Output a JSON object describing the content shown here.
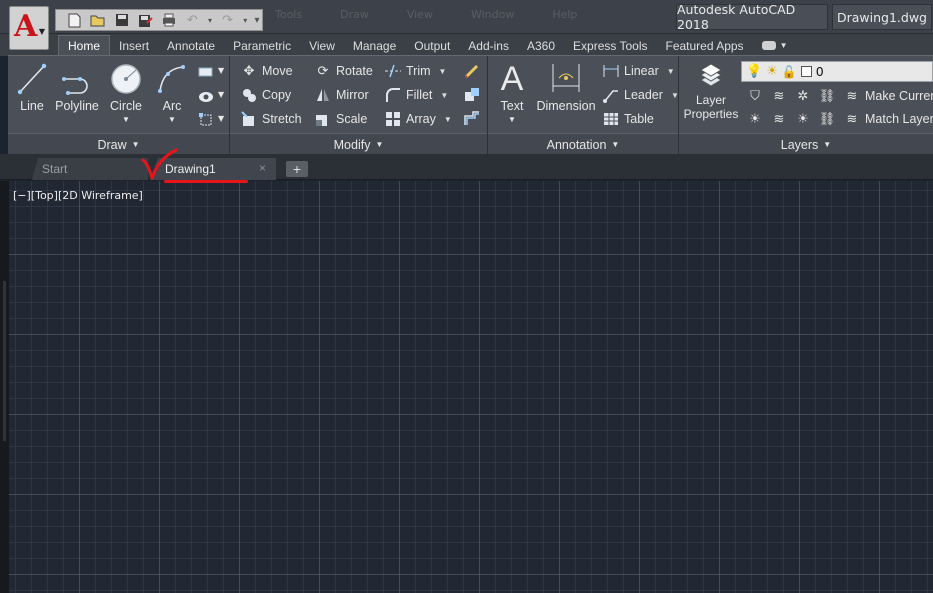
{
  "titlebar": {
    "app_title": "Autodesk AutoCAD 2018",
    "doc_title": "Drawing1.dwg",
    "app_logo": "A",
    "qat_icons": [
      "new-icon",
      "open-icon",
      "save-icon",
      "save-as-icon",
      "plot-icon",
      "undo-icon",
      "redo-icon"
    ],
    "faded_menu": [
      "Tools",
      "Draw",
      "View",
      "Window",
      "Help"
    ]
  },
  "ribbon_tabs": [
    {
      "label": "Home",
      "active": true
    },
    {
      "label": "Insert"
    },
    {
      "label": "Annotate"
    },
    {
      "label": "Parametric"
    },
    {
      "label": "View"
    },
    {
      "label": "Manage"
    },
    {
      "label": "Output"
    },
    {
      "label": "Add-ins"
    },
    {
      "label": "A360"
    },
    {
      "label": "Express Tools"
    },
    {
      "label": "Featured Apps"
    }
  ],
  "panels": {
    "draw": {
      "title": "Draw",
      "line": "Line",
      "polyline": "Polyline",
      "circle": "Circle",
      "arc": "Arc"
    },
    "modify": {
      "title": "Modify",
      "move": "Move",
      "rotate": "Rotate",
      "trim": "Trim",
      "copy": "Copy",
      "mirror": "Mirror",
      "fillet": "Fillet",
      "stretch": "Stretch",
      "scale": "Scale",
      "array": "Array"
    },
    "annotation": {
      "title": "Annotation",
      "text": "Text",
      "dimension": "Dimension",
      "linear": "Linear",
      "leader": "Leader",
      "table": "Table"
    },
    "layers": {
      "title": "Layers",
      "layer_props_line1": "Layer",
      "layer_props_line2": "Properties",
      "current_layer": "0",
      "make_current": "Make Current",
      "match_layer": "Match Layer"
    }
  },
  "doc_tabs": {
    "start": "Start",
    "drawing": "Drawing1",
    "close": "×",
    "new": "+"
  },
  "viewport": {
    "label": "[−][Top][2D Wireframe]"
  },
  "colors": {
    "canvas": "#212834",
    "ribbon": "#4b4f57",
    "annotation_red": "#e8141a",
    "logo_red": "#c8151b"
  }
}
